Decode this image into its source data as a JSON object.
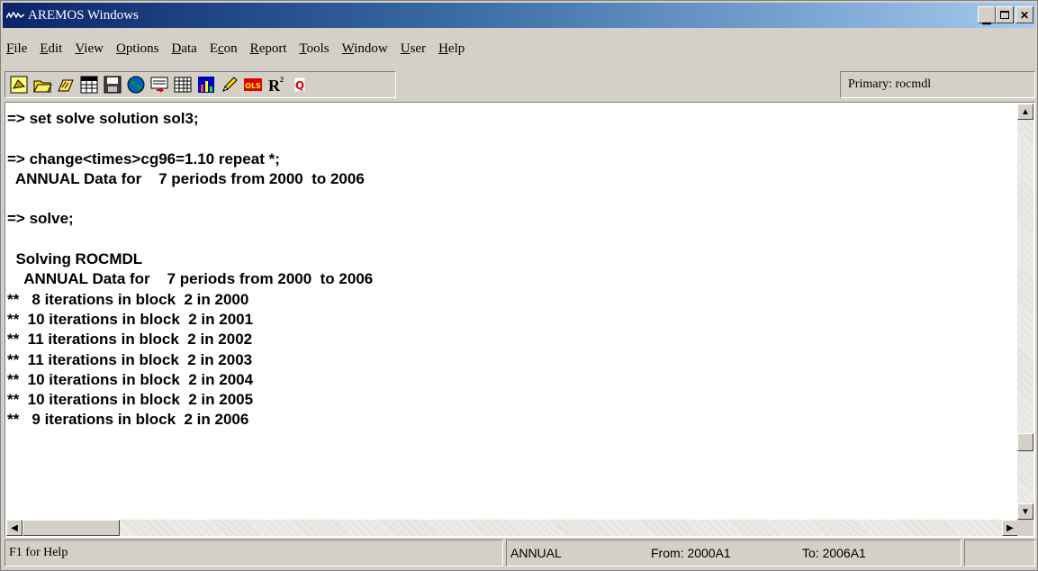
{
  "window": {
    "title": "AREMOS Windows",
    "controls": {
      "minimize": "_",
      "maximize": "□",
      "close": "✕"
    }
  },
  "menu": [
    {
      "label": "File",
      "underline": "F"
    },
    {
      "label": "Edit",
      "underline": "E"
    },
    {
      "label": "View",
      "underline": "V"
    },
    {
      "label": "Options",
      "underline": "O"
    },
    {
      "label": "Data",
      "underline": "D"
    },
    {
      "label": "Econ",
      "underline": "c"
    },
    {
      "label": "Report",
      "underline": "R"
    },
    {
      "label": "Tools",
      "underline": "T"
    },
    {
      "label": "Window",
      "underline": "W"
    },
    {
      "label": "User",
      "underline": "U"
    },
    {
      "label": "Help",
      "underline": "H"
    }
  ],
  "toolbar": {
    "icons": [
      "new-icon",
      "open-folder-icon",
      "open-databank-icon",
      "series-icon",
      "save-icon",
      "globe-icon",
      "report-icon",
      "table-icon",
      "chart-icon",
      "edit-pencil-icon",
      "ols-icon",
      "r-squared-icon",
      "quit-icon"
    ],
    "ols_label": "OLS",
    "r2_label": "R",
    "r2_sup": "2",
    "quit_label": "Q",
    "primary": "Primary: rocmdl"
  },
  "console": {
    "lines": [
      "=> set solve solution sol3;",
      "",
      "=> change<times>cg96=1.10 repeat *;",
      "  ANNUAL Data for    7 periods from 2000  to 2006",
      "",
      "=> solve;",
      "",
      "  Solving ROCMDL",
      "    ANNUAL Data for    7 periods from 2000  to 2006",
      "**   8 iterations in block  2 in 2000",
      "**  10 iterations in block  2 in 2001",
      "**  11 iterations in block  2 in 2002",
      "**  11 iterations in block  2 in 2003",
      "**  10 iterations in block  2 in 2004",
      "**  10 iterations in block  2 in 2005",
      "**   9 iterations in block  2 in 2006"
    ]
  },
  "statusbar": {
    "help": "F1 for Help",
    "frequency": "ANNUAL",
    "from": "From:  2000A1",
    "to": "To:  2006A1"
  },
  "colors": {
    "title_start": "#0a246a",
    "title_end": "#a6caf0",
    "face": "#d4d0c8",
    "console_bg": "#ffffff"
  }
}
